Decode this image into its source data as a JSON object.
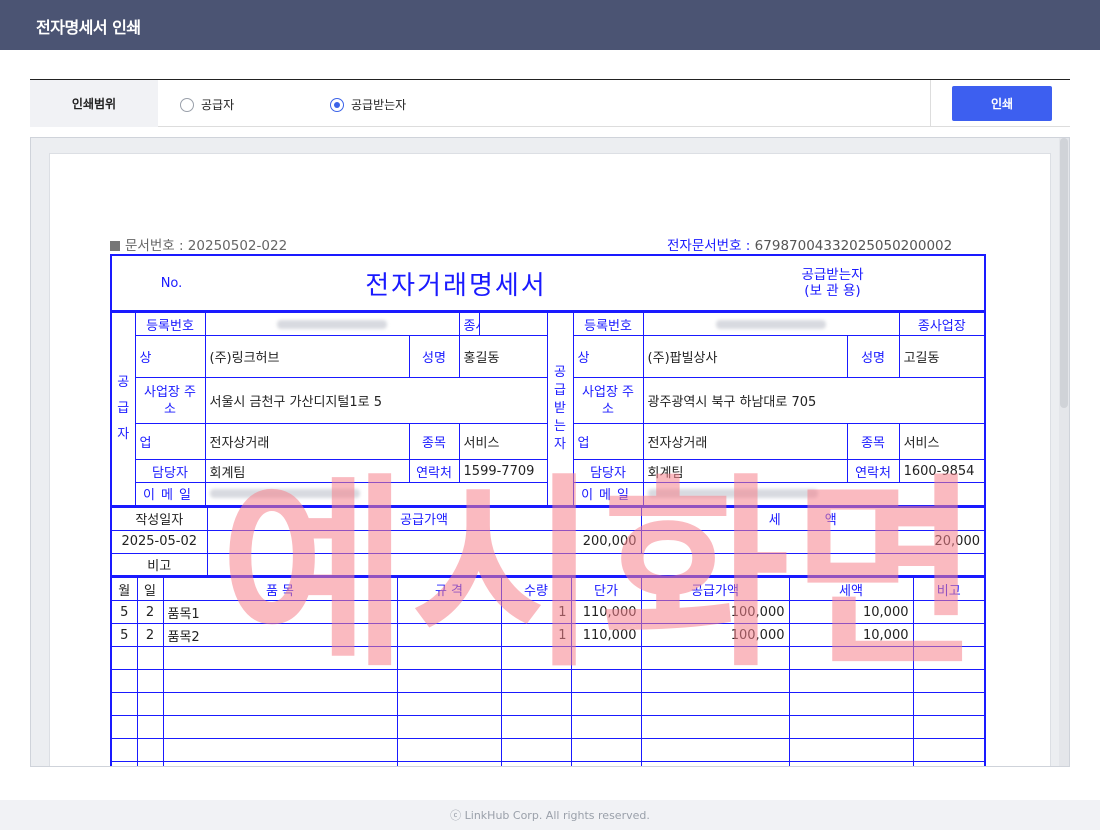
{
  "header": {
    "title": "전자명세서 인쇄"
  },
  "print_range": {
    "label": "인쇄범위",
    "options": [
      {
        "label": "공급자",
        "checked": false
      },
      {
        "label": "공급받는자",
        "checked": true
      }
    ],
    "print_button": "인쇄"
  },
  "doc": {
    "doc_no_label": "문서번호 : 20250502-022",
    "edoc_no_label": "전자문서번호 :",
    "edoc_no": "67987004332025050200002",
    "no_label": "No.",
    "title": "전자거래명세서",
    "copy_type_line1": "공급받는자",
    "copy_type_line2": "(보 관 용)",
    "watermark": "예시화면",
    "supplier": {
      "side_label": "공급자",
      "reg_no_label": "등록번호",
      "branch_label": "종사업장",
      "name_label": "상 호",
      "name": "(주)링크허브",
      "ceo_label": "성명",
      "ceo": "홍길동",
      "addr_label": "사업장 주소",
      "addr": "서울시 금천구 가산디지털1로 5",
      "biztype_label": "업 태",
      "biztype": "전자상거래",
      "bizclass_label": "종목",
      "bizclass": "서비스",
      "contact_label": "담당자",
      "contact": "회계팀",
      "tel_label": "연락처",
      "tel": "1599-7709",
      "email_label": "이메일"
    },
    "buyer": {
      "side_label": "공급받는자",
      "reg_no_label": "등록번호",
      "branch_label": "종사업장",
      "name_label": "상 호",
      "name": "(주)팝빌상사",
      "ceo_label": "성명",
      "ceo": "고길동",
      "addr_label": "사업장 주소",
      "addr": "광주광역시 북구 하남대로 705",
      "biztype_label": "업 태",
      "biztype": "전자상거래",
      "bizclass_label": "종목",
      "bizclass": "서비스",
      "contact_label": "담당자",
      "contact": "회계팀",
      "tel_label": "연락처",
      "tel": "1600-9854",
      "email_label": "이메일"
    },
    "summary": {
      "date_label": "작성일자",
      "supply_label": "공급가액",
      "tax_label": "세 액",
      "date": "2025-05-02",
      "supply": "200,000",
      "tax": "20,000",
      "note_label": "비고"
    },
    "items_header": [
      "월",
      "일",
      "품 목",
      "규 격",
      "수량",
      "단가",
      "공급가액",
      "세액",
      "비고"
    ],
    "items": [
      [
        "5",
        "2",
        "품목1",
        "",
        "1",
        "110,000",
        "100,000",
        "10,000",
        ""
      ],
      [
        "5",
        "2",
        "품목2",
        "",
        "1",
        "110,000",
        "100,000",
        "10,000",
        ""
      ]
    ]
  },
  "footer": {
    "text": "ⓒ LinkHub Corp. All rights reserved."
  }
}
